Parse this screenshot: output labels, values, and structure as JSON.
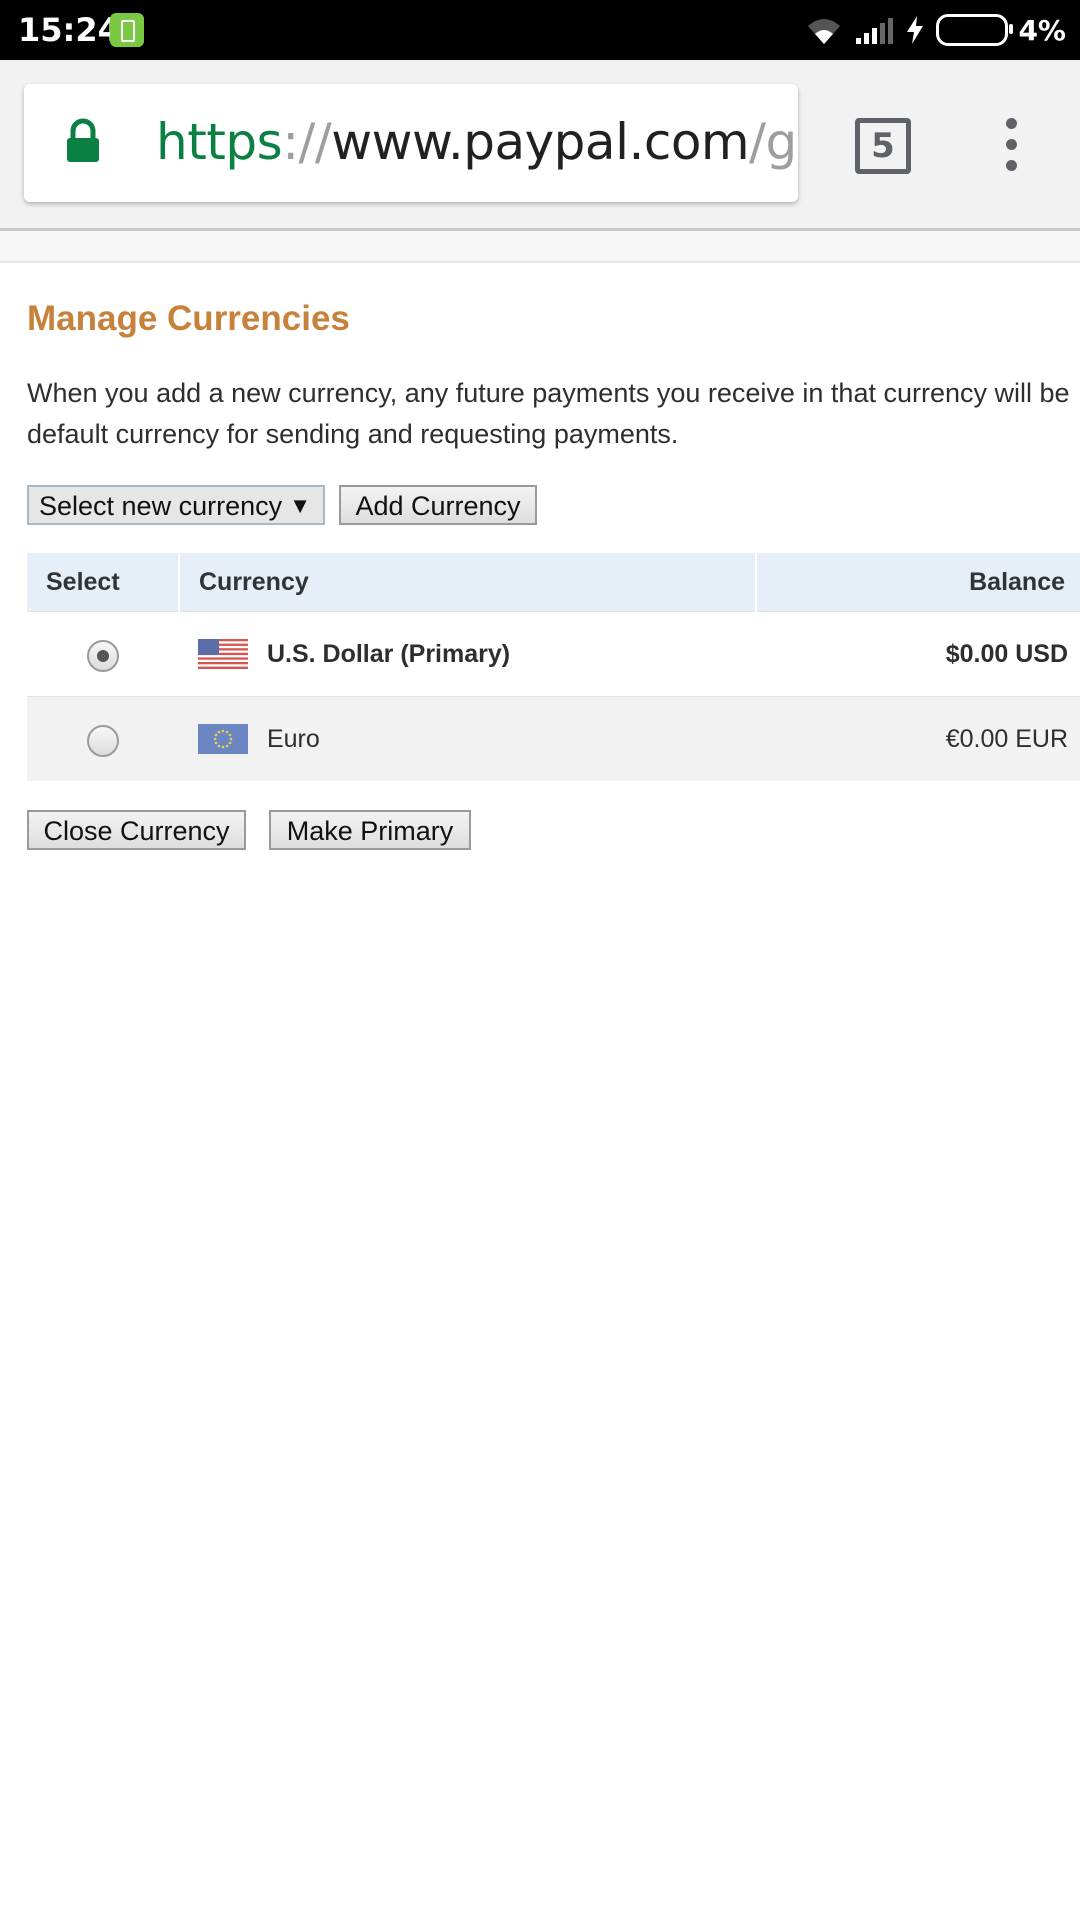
{
  "status_bar": {
    "time": "15:24",
    "battery_percent": "4%"
  },
  "browser": {
    "url_scheme": "https",
    "url_separator": "://",
    "url_host": "www.paypal.com",
    "url_path": "/gr/cgi-bin/webscr",
    "tab_count": "5"
  },
  "page": {
    "title": "Manage Currencies",
    "description": "When you add a new currency, any future payments you receive in that currency will be",
    "description_line2": "default currency for sending and requesting payments.",
    "select_currency_label": "Select new currency",
    "add_currency_label": "Add Currency",
    "table": {
      "headers": {
        "select": "Select",
        "currency": "Currency",
        "balance": "Balance"
      },
      "rows": [
        {
          "currency": "U.S. Dollar (Primary)",
          "balance": "$0.00 USD",
          "selected": true,
          "flag": "us-flag-icon"
        },
        {
          "currency": "Euro",
          "balance": "€0.00 EUR",
          "selected": false,
          "flag": "eu-flag-icon"
        }
      ]
    },
    "close_currency_label": "Close Currency",
    "make_primary_label": "Make Primary"
  },
  "colors": {
    "title": "#c7813a",
    "header_bg": "#e6eef8",
    "url_scheme": "#0b8043",
    "lock": "#0b8043"
  }
}
